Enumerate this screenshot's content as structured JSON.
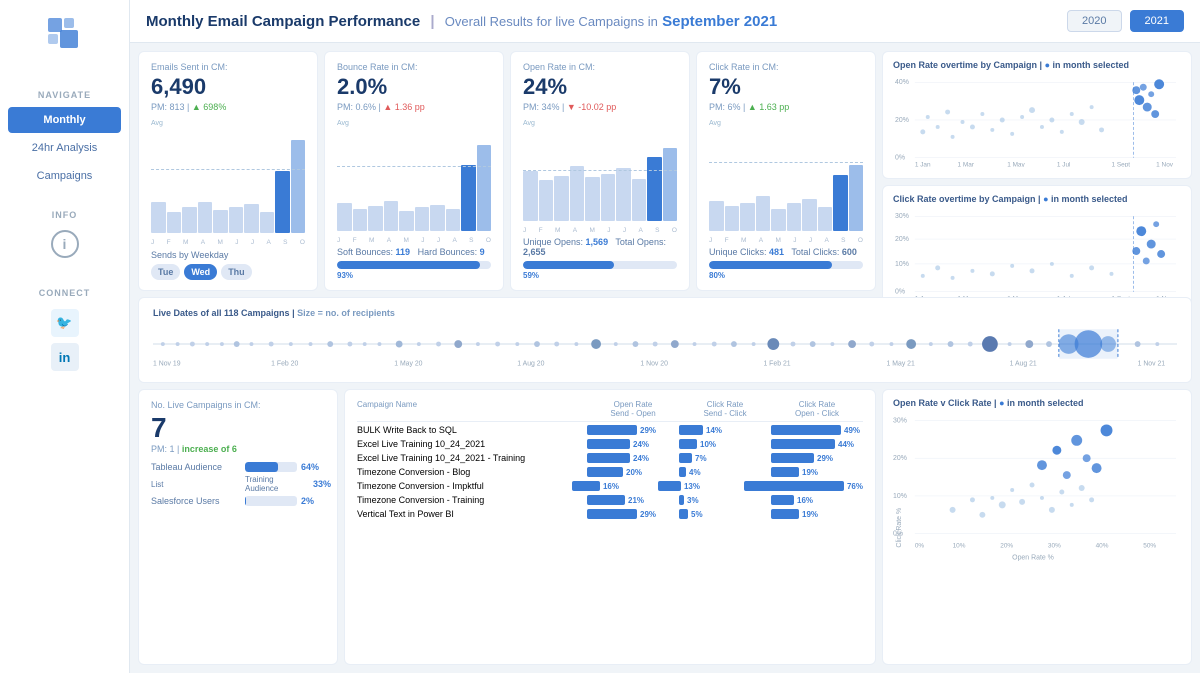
{
  "sidebar": {
    "navigate_label": "NAVIGATE",
    "items": [
      {
        "label": "Monthly",
        "active": true
      },
      {
        "label": "24hr Analysis",
        "active": false
      },
      {
        "label": "Campaigns",
        "active": false
      }
    ],
    "info_label": "INFO",
    "connect_label": "CONNECT"
  },
  "header": {
    "title_prefix": "Monthly Email Campaign Performance",
    "separator": "|",
    "subtitle": "Overall Results for live Campaigns in",
    "month_highlight": "September 2021",
    "year_buttons": [
      "2020",
      "2021"
    ],
    "active_year": "2021"
  },
  "metrics": [
    {
      "id": "emails_sent",
      "title": "Emails Sent in CM:",
      "value": "6,490",
      "pm_label": "PM: 813",
      "pm_change": "698%",
      "pm_direction": "up",
      "chart_bars": [
        30,
        20,
        25,
        30,
        22,
        25,
        28,
        20,
        18,
        55,
        90
      ],
      "chart_months": [
        "J",
        "F",
        "M",
        "A",
        "M",
        "J",
        "J",
        "A",
        "S",
        "O"
      ],
      "avg_pct": 35,
      "footer_type": "weekday",
      "weekdays": [
        {
          "label": "Tue",
          "active": false
        },
        {
          "label": "Wed",
          "active": true
        },
        {
          "label": "Thu",
          "active": false
        }
      ],
      "footer_label": "Sends by Weekday"
    },
    {
      "id": "bounce_rate",
      "title": "Bounce Rate in CM:",
      "value": "2.0%",
      "pm_label": "PM: 0.6%",
      "pm_change": "1.36 pp",
      "pm_direction": "up_bad",
      "chart_bars": [
        25,
        20,
        22,
        28,
        20,
        24,
        26,
        22,
        20,
        60,
        85
      ],
      "chart_months": [
        "J",
        "F",
        "M",
        "A",
        "M",
        "J",
        "J",
        "A",
        "S",
        "O"
      ],
      "avg_pct": 30,
      "footer_type": "bars",
      "soft_bounces": "119",
      "hard_bounces": "9",
      "bar_pct": 93,
      "bar_label": "93%"
    },
    {
      "id": "open_rate",
      "title": "Open Rate in CM:",
      "value": "24%",
      "pm_label": "PM: 34%",
      "pm_change": "-10.02 pp",
      "pm_direction": "down",
      "chart_bars": [
        55,
        45,
        50,
        60,
        48,
        52,
        58,
        46,
        44,
        70,
        80
      ],
      "chart_months": [
        "J",
        "F",
        "M",
        "A",
        "M",
        "J",
        "J",
        "A",
        "S",
        "O"
      ],
      "avg_pct": 40,
      "footer_type": "bars",
      "unique_opens": "1,569",
      "total_opens": "2,655",
      "bar_pct": 59,
      "bar_label": "59%"
    },
    {
      "id": "click_rate",
      "title": "Click Rate in CM:",
      "value": "7%",
      "pm_label": "PM: 6%",
      "pm_change": "1.63 pp",
      "pm_direction": "up",
      "chart_bars": [
        30,
        25,
        28,
        35,
        22,
        28,
        32,
        24,
        22,
        50,
        65
      ],
      "chart_months": [
        "J",
        "F",
        "M",
        "A",
        "M",
        "J",
        "J",
        "A",
        "S",
        "O"
      ],
      "avg_pct": 32,
      "footer_type": "bars",
      "unique_clicks": "481",
      "total_clicks": "600",
      "bar_pct": 80,
      "bar_label": "80%"
    }
  ],
  "timeline": {
    "title": "Live Dates of all 118 Campaigns",
    "size_note": "Size = no. of recipients",
    "labels": [
      "1 Nov 19",
      "1 Feb 20",
      "1 May 20",
      "1 Aug 20",
      "1 Nov 20",
      "1 Feb 21",
      "1 May 21",
      "1 Aug 21",
      "1 Nov 21"
    ]
  },
  "bottom_left": {
    "title": "No. Live Campaigns in CM:",
    "value": "7",
    "pm_label": "PM: 1",
    "pm_change": "increase of 6",
    "audiences": [
      {
        "label": "Tableau Audience",
        "pct": 64
      },
      {
        "label": "Training Audience",
        "pct": 33
      },
      {
        "label": "Salesforce Users",
        "pct": 2
      }
    ]
  },
  "campaign_table": {
    "title": "Campaign Name",
    "headers": [
      "Open Rate\nSend - Open",
      "Click Rate\nSend - Click",
      "Click Rate\nOpen - Click"
    ],
    "rows": [
      {
        "name": "BULK Write Back to SQL",
        "open_rate": 29,
        "click_rate_send": 14,
        "click_rate_open": 49
      },
      {
        "name": "Excel Live Training 10_24_2021",
        "open_rate": 24,
        "click_rate_send": 10,
        "click_rate_open": 44
      },
      {
        "name": "Excel Live Training 10_24_2021 - Training",
        "open_rate": 24,
        "click_rate_send": 7,
        "click_rate_open": 29
      },
      {
        "name": "Timezone Conversion - Blog",
        "open_rate": 20,
        "click_rate_send": 4,
        "click_rate_open": 19
      },
      {
        "name": "Timezone Conversion - Impktful",
        "open_rate": 16,
        "click_rate_send": 13,
        "click_rate_open": 76
      },
      {
        "name": "Timezone Conversion - Training",
        "open_rate": 21,
        "click_rate_send": 3,
        "click_rate_open": 16
      },
      {
        "name": "Vertical Text in Power BI",
        "open_rate": 29,
        "click_rate_send": 5,
        "click_rate_open": 19
      }
    ]
  },
  "chart_open_rate": {
    "title": "Open Rate overtime by Campaign",
    "dot_label": "in month selected",
    "x_labels": [
      "1 Jan",
      "1 Mar",
      "1 May",
      "1 Jul",
      "1 Sept",
      "1 Nov"
    ],
    "y_labels": [
      "40%",
      "20%",
      "0%"
    ]
  },
  "chart_click_rate": {
    "title": "Click Rate overtime by Campaign",
    "dot_label": "in month selected",
    "x_labels": [
      "1 Jan",
      "1 Mar",
      "1 May",
      "1 Jul",
      "1 Sept",
      "1 Nov"
    ],
    "y_labels": [
      "30%",
      "20%",
      "10%",
      "0%"
    ]
  },
  "chart_scatter": {
    "title": "Open Rate v Click Rate",
    "dot_label": "in month selected",
    "x_labels": [
      "0%",
      "10%",
      "20%",
      "30%",
      "40%",
      "50%"
    ],
    "y_labels": [
      "30%",
      "20%",
      "10%",
      "0%"
    ],
    "x_axis_label": "Open Rate %",
    "y_axis_label": "Click Rate %"
  }
}
